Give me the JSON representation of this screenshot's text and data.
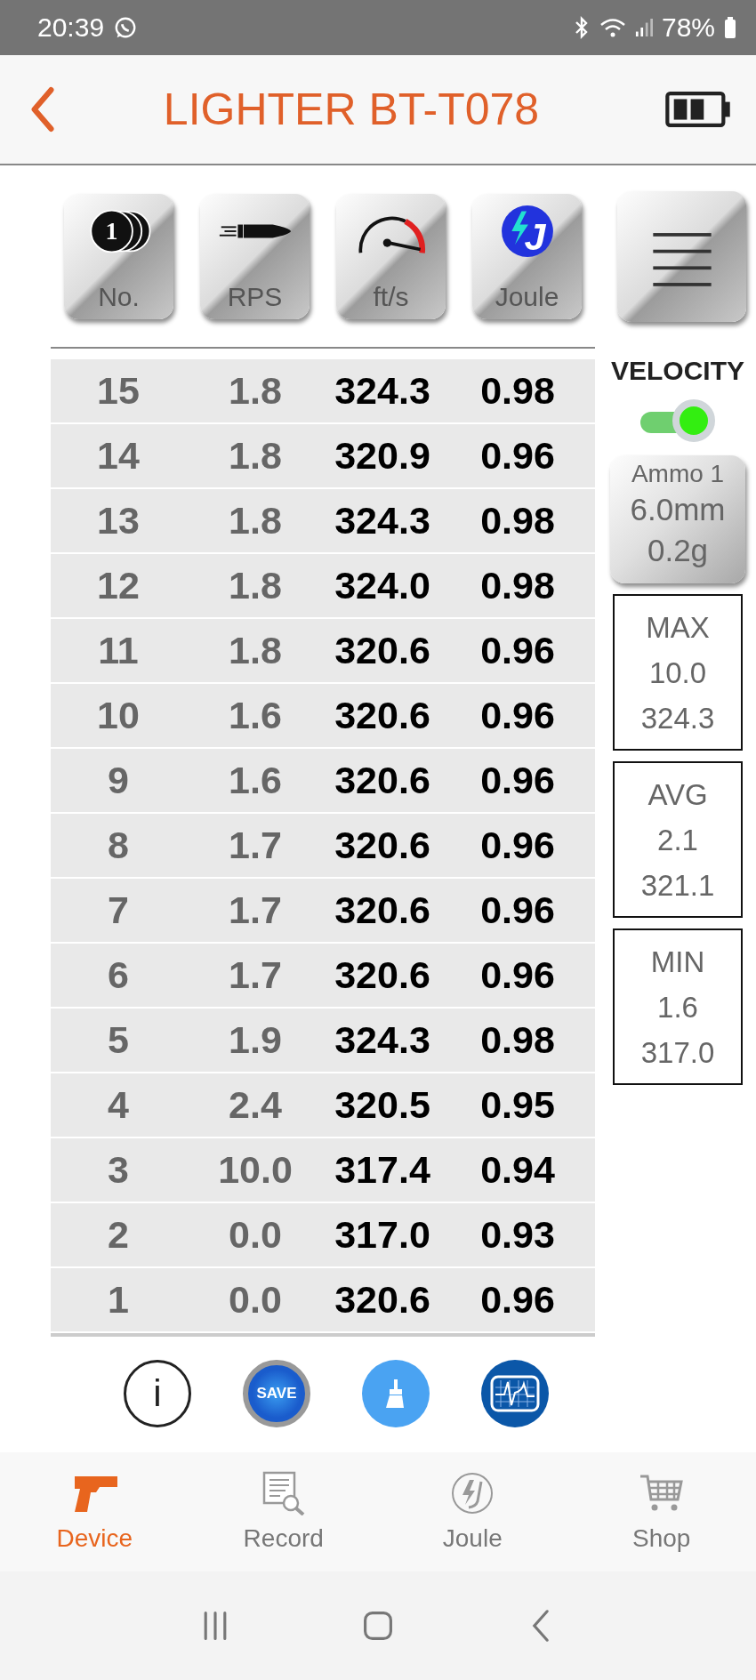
{
  "status_bar": {
    "time": "20:39",
    "battery": "78%"
  },
  "header": {
    "title": "LIGHTER BT-T078"
  },
  "toolbar": [
    {
      "kind": "count",
      "label": "No.",
      "badge": "1"
    },
    {
      "kind": "rps",
      "label": "RPS"
    },
    {
      "kind": "speed",
      "label": "ft/s"
    },
    {
      "kind": "joule",
      "label": "Joule",
      "badge": "J"
    },
    {
      "kind": "menu"
    }
  ],
  "mode": {
    "label": "VELOCITY",
    "on": true
  },
  "ammo": {
    "lines": [
      "Ammo 1",
      "6.0mm",
      "0.2g"
    ]
  },
  "stats": [
    {
      "label": "MAX",
      "rps": "10.0",
      "velocity": "324.3"
    },
    {
      "label": "AVG",
      "rps": "2.1",
      "velocity": "321.1"
    },
    {
      "label": "MIN",
      "rps": "1.6",
      "velocity": "317.0"
    }
  ],
  "table": {
    "rows": [
      {
        "no": "15",
        "rps": "1.8",
        "fps": "324.3",
        "joule": "0.98"
      },
      {
        "no": "14",
        "rps": "1.8",
        "fps": "320.9",
        "joule": "0.96"
      },
      {
        "no": "13",
        "rps": "1.8",
        "fps": "324.3",
        "joule": "0.98"
      },
      {
        "no": "12",
        "rps": "1.8",
        "fps": "324.0",
        "joule": "0.98"
      },
      {
        "no": "11",
        "rps": "1.8",
        "fps": "320.6",
        "joule": "0.96"
      },
      {
        "no": "10",
        "rps": "1.6",
        "fps": "320.6",
        "joule": "0.96"
      },
      {
        "no": "9",
        "rps": "1.6",
        "fps": "320.6",
        "joule": "0.96"
      },
      {
        "no": "8",
        "rps": "1.7",
        "fps": "320.6",
        "joule": "0.96"
      },
      {
        "no": "7",
        "rps": "1.7",
        "fps": "320.6",
        "joule": "0.96"
      },
      {
        "no": "6",
        "rps": "1.7",
        "fps": "320.6",
        "joule": "0.96"
      },
      {
        "no": "5",
        "rps": "1.9",
        "fps": "324.3",
        "joule": "0.98"
      },
      {
        "no": "4",
        "rps": "2.4",
        "fps": "320.5",
        "joule": "0.95"
      },
      {
        "no": "3",
        "rps": "10.0",
        "fps": "317.4",
        "joule": "0.94"
      },
      {
        "no": "2",
        "rps": "0.0",
        "fps": "317.0",
        "joule": "0.93"
      },
      {
        "no": "1",
        "rps": "0.0",
        "fps": "320.6",
        "joule": "0.96"
      }
    ]
  },
  "actions": [
    {
      "kind": "info",
      "label": "i"
    },
    {
      "kind": "save",
      "label": "SAVE"
    },
    {
      "kind": "clean"
    },
    {
      "kind": "scope"
    }
  ],
  "tabs": [
    {
      "kind": "device",
      "label": "Device",
      "selected": true
    },
    {
      "kind": "record",
      "label": "Record",
      "selected": false
    },
    {
      "kind": "joule",
      "label": "Joule",
      "selected": false
    },
    {
      "kind": "shop",
      "label": "Shop",
      "selected": false
    }
  ]
}
